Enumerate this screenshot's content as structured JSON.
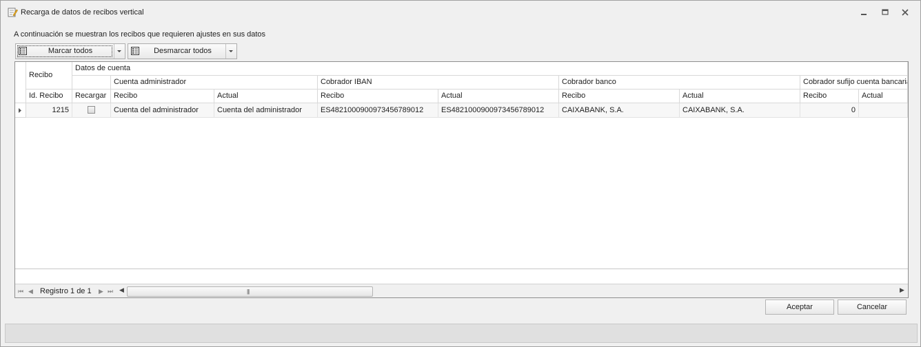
{
  "window": {
    "title": "Recarga de datos de recibos vertical"
  },
  "intro_text": "A continuación se muestran los recibos que requieren ajustes en sus datos",
  "toolbar": {
    "mark_all_label": "Marcar todos",
    "unmark_all_label": "Desmarcar todos"
  },
  "grid": {
    "band_top": {
      "recibo": "Recibo",
      "datos_cuenta": "Datos de cuenta"
    },
    "band_mid": {
      "cuenta_admin": "Cuenta administrador",
      "cobrador_iban": "Cobrador IBAN",
      "cobrador_banco": "Cobrador banco",
      "cobrador_sufijo": "Cobrador sufijo cuenta bancaria"
    },
    "columns": {
      "id_recibo": "Id. Recibo",
      "recargar": "Recargar",
      "admin_recibo": "Recibo",
      "admin_actual": "Actual",
      "iban_recibo": "Recibo",
      "iban_actual": "Actual",
      "banco_recibo": "Recibo",
      "banco_actual": "Actual",
      "sufijo_recibo": "Recibo",
      "sufijo_actual": "Actual"
    },
    "rows": [
      {
        "id_recibo": "1215",
        "recargar": false,
        "admin_recibo": "Cuenta del administrador",
        "admin_actual": "Cuenta del administrador",
        "iban_recibo": "ES4821000900973456789012",
        "iban_actual": "ES4821000900973456789012",
        "banco_recibo": "CAIXABANK, S.A.",
        "banco_actual": "CAIXABANK, S.A.",
        "sufijo_recibo": "0",
        "sufijo_actual": ""
      }
    ],
    "navigator_text": "Registro 1 de 1"
  },
  "buttons": {
    "accept": "Aceptar",
    "cancel": "Cancelar"
  },
  "colors": {
    "row_bg": "#f7f7f7",
    "header_bg": "#ffffff",
    "window_bg": "#f0f0f0"
  }
}
